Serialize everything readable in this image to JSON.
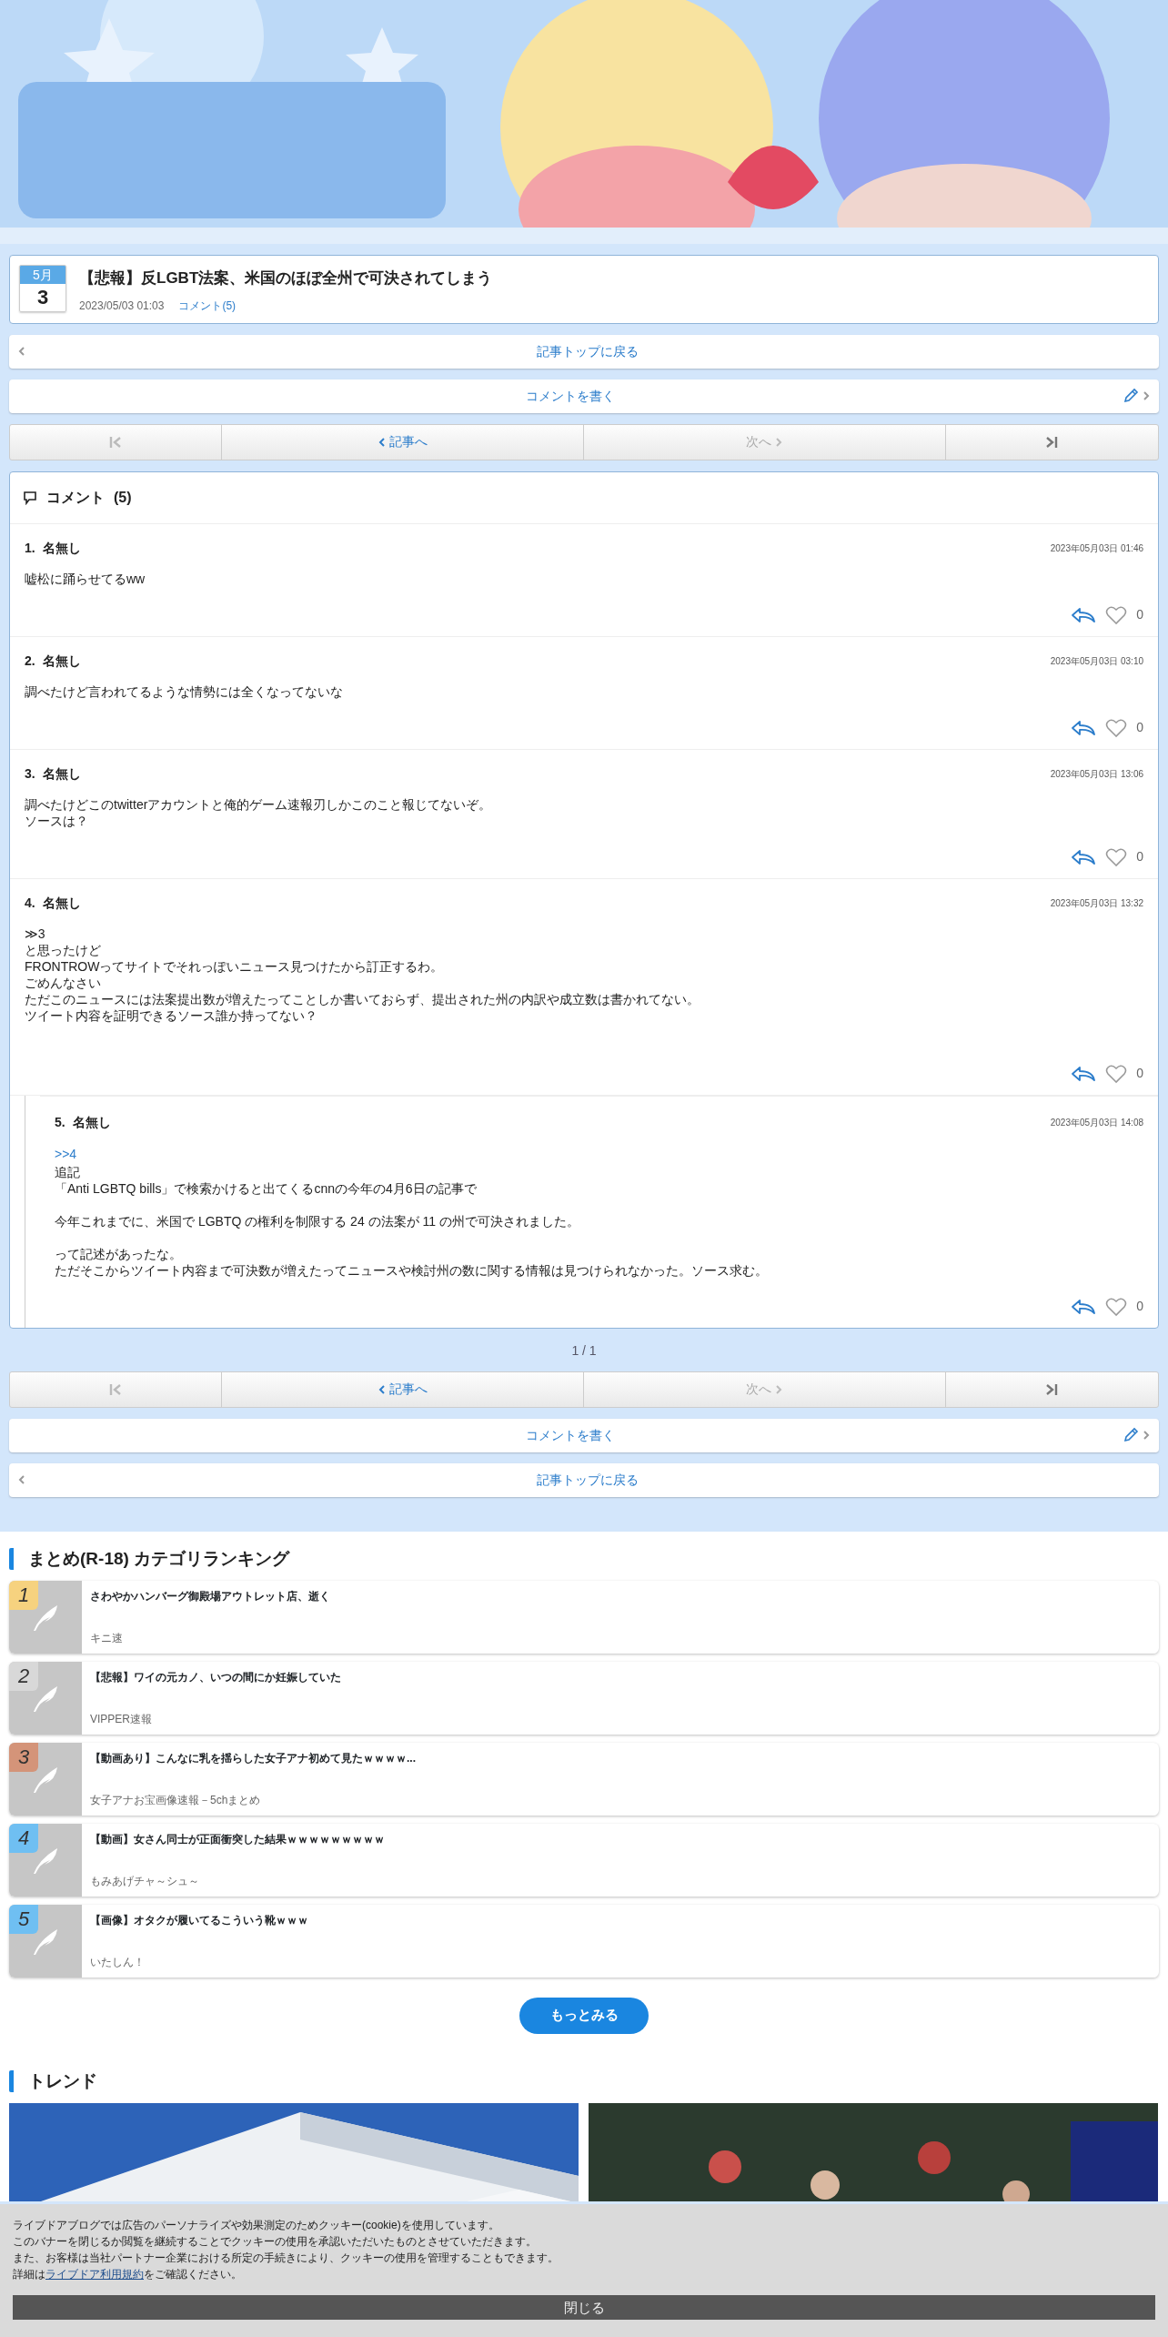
{
  "article": {
    "month": "5月",
    "day": "3",
    "title": "【悲報】反LGBT法案、米国のほぼ全州で可決されてしまう",
    "datetime": "2023/05/03 01:03",
    "comments_link": "コメント(5)"
  },
  "top_links": [
    {
      "kind": "back",
      "label": "記事トップに戻る"
    },
    {
      "kind": "write",
      "label": "コメントを書く"
    }
  ],
  "pager_top": [
    {
      "kind": "first",
      "disabled": true
    },
    {
      "kind": "prev",
      "label": "記事へ",
      "disabled": false
    },
    {
      "kind": "next",
      "label": "次へ",
      "disabled": true
    },
    {
      "kind": "last",
      "disabled": false
    }
  ],
  "comments": {
    "title": "コメント",
    "count": "(5)",
    "items": [
      {
        "number": "1.",
        "name": "名無し",
        "date": "2023年05月03日 01:46",
        "paragraphs": [
          [
            "嘘松に踊らせてるww"
          ]
        ],
        "likes": "0"
      },
      {
        "number": "2.",
        "name": "名無し",
        "date": "2023年05月03日 03:10",
        "paragraphs": [
          [
            "調べたけど言われてるような情勢には全くなってないな"
          ]
        ],
        "likes": "0"
      },
      {
        "number": "3.",
        "name": "名無し",
        "date": "2023年05月03日 13:06",
        "paragraphs": [
          [
            "調べたけどこのtwitterアカウントと俺的ゲーム速報刃しかこのこと報じてないぞ。",
            "ソースは？"
          ]
        ],
        "likes": "0"
      },
      {
        "number": "4.",
        "name": "名無し",
        "date": "2023年05月03日 13:32",
        "paragraphs": [
          [
            "≫3",
            "と思ったけど",
            "FRONTROWってサイトでそれっぽいニュース見つけたから訂正するわ。",
            "ごめんなさい",
            "ただこのニュースには法案提出数が増えたってことしか書いておらず、提出された州の内訳や成立数は書かれてない。",
            "ツイート内容を証明できるソース誰か持ってない？"
          ]
        ],
        "likes": "0",
        "children": [
          {
            "number": "5.",
            "name": "名無し",
            "date": "2023年05月03日 14:08",
            "reply_to": ">>4",
            "paragraphs": [
              [
                "追記",
                "「Anti LGBTQ bills」で検索かけると出てくるcnnの今年の4月6日の記事で"
              ],
              [
                "今年これまでに、米国で LGBTQ の権利を制限する 24 の法案が 11 の州で可決されました。"
              ],
              [
                "って記述があったな。",
                "ただそこからツイート内容まで可決数が増えたってニュースや検討州の数に関する情報は見つけられなかった。ソース求む。"
              ]
            ],
            "likes": "0"
          }
        ]
      }
    ]
  },
  "page_count": "1 / 1",
  "pager_bottom": [
    {
      "kind": "first",
      "disabled": true
    },
    {
      "kind": "prev",
      "label": "記事へ",
      "disabled": false
    },
    {
      "kind": "next",
      "label": "次へ",
      "disabled": true
    },
    {
      "kind": "last",
      "disabled": false
    }
  ],
  "bottom_links": [
    {
      "kind": "write",
      "label": "コメントを書く"
    },
    {
      "kind": "back",
      "label": "記事トップに戻る"
    }
  ],
  "ranking": {
    "title": "まとめ(R-18) カテゴリランキング",
    "items": [
      {
        "rank": "1",
        "title": "さわやかハンバーグ御殿場アウトレット店、逝く",
        "source": "キニ速",
        "color": "#f6d27f"
      },
      {
        "rank": "2",
        "title": "【悲報】ワイの元カノ、いつの間にか妊娠していた",
        "source": "VIPPER速報",
        "color": "#d8d8d8"
      },
      {
        "rank": "3",
        "title": "【動画あり】こんなに乳を揺らした女子アナ初めて見たｗｗｗｗ...",
        "source": "女子アナお宝画像速報－5chまとめ",
        "color": "#d49479"
      },
      {
        "rank": "4",
        "title": "【動画】女さん同士が正面衝突した結果ｗｗｗｗｗｗｗｗｗ",
        "source": "もみあげチャ～シュ～",
        "color": "#6fbff2"
      },
      {
        "rank": "5",
        "title": "【画像】オタクが履いてるこういう靴ｗｗｗ",
        "source": "いたしん！",
        "color": "#6fbff2"
      }
    ],
    "more": "もっとみる"
  },
  "trend": {
    "title": "トレンド"
  },
  "cookie": {
    "lines": [
      "ライブドアブログでは広告のパーソナライズや効果測定のためクッキー(cookie)を使用しています。",
      "このバナーを閉じるか閲覧を継続することでクッキーの使用を承認いただいたものとさせていただきます。",
      "また、お客様は当社パートナー企業における所定の手続きにより、クッキーの使用を管理することもできます。"
    ],
    "detail_before": "詳細は",
    "detail_link": "ライブドア利用規約",
    "detail_after": "をご確認ください。",
    "close": "閉じる"
  }
}
